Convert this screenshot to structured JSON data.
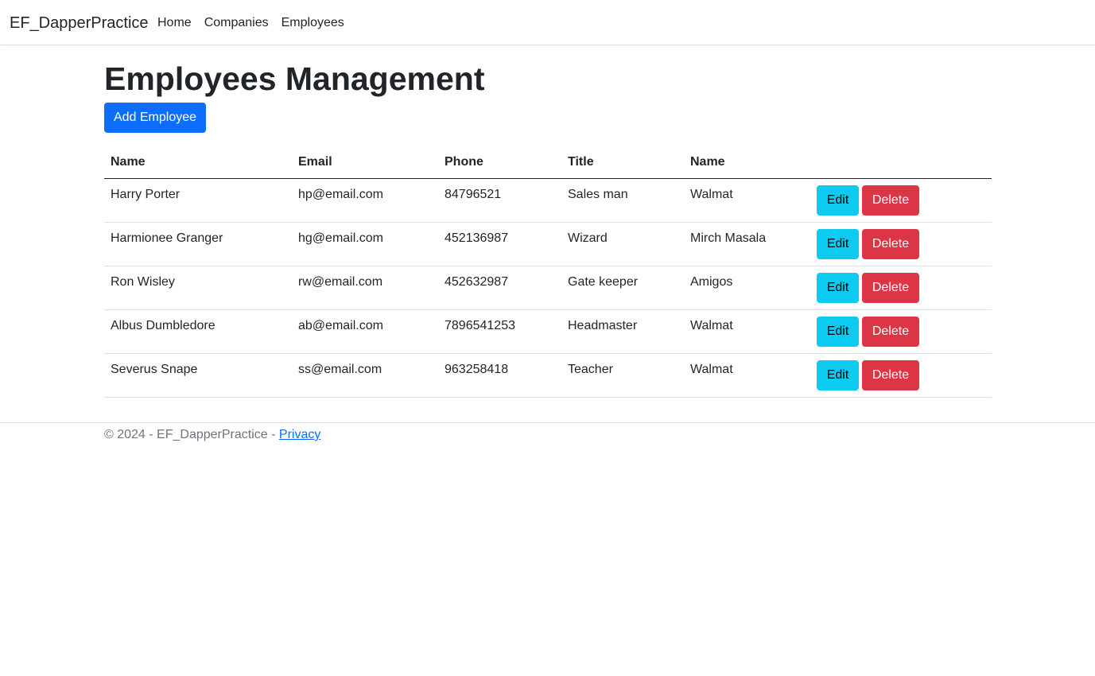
{
  "navbar": {
    "brand": "EF_DapperPractice",
    "links": [
      {
        "label": "Home"
      },
      {
        "label": "Companies"
      },
      {
        "label": "Employees"
      }
    ]
  },
  "main": {
    "title": "Employees Management",
    "add_button": "Add Employee",
    "table": {
      "headers": [
        "Name",
        "Email",
        "Phone",
        "Title",
        "Name",
        ""
      ],
      "rows": [
        {
          "name": "Harry Porter",
          "email": "hp@email.com",
          "phone": "84796521",
          "title": "Sales man",
          "company": "Walmat"
        },
        {
          "name": "Harmionee Granger",
          "email": "hg@email.com",
          "phone": "452136987",
          "title": "Wizard",
          "company": "Mirch Masala"
        },
        {
          "name": "Ron Wisley",
          "email": "rw@email.com",
          "phone": "452632987",
          "title": "Gate keeper",
          "company": "Amigos"
        },
        {
          "name": "Albus Dumbledore",
          "email": "ab@email.com",
          "phone": "7896541253",
          "title": "Headmaster",
          "company": "Walmat"
        },
        {
          "name": "Severus Snape",
          "email": "ss@email.com",
          "phone": "963258418",
          "title": "Teacher",
          "company": "Walmat"
        }
      ],
      "edit_label": "Edit",
      "delete_label": "Delete"
    }
  },
  "footer": {
    "text": "© 2024 - EF_DapperPractice - ",
    "link": "Privacy"
  },
  "colors": {
    "primary": "#0d6efd",
    "info": "#0dcaf0",
    "danger": "#dc3545"
  }
}
